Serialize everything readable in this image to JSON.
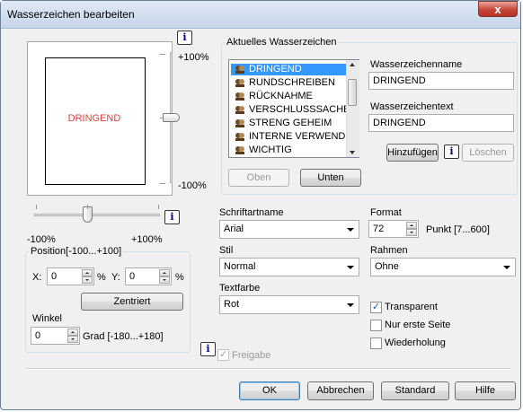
{
  "window": {
    "title": "Wasserzeichen bearbeiten",
    "close": "x"
  },
  "preview": {
    "text": "DRINGEND"
  },
  "slider_v": {
    "top": "+100%",
    "bottom": "-100%"
  },
  "slider_h": {
    "left": "-100%",
    "right": "+100%"
  },
  "info_glyph": "i",
  "position": {
    "group": "Position[-100...+100]",
    "x_label": "X:",
    "x_value": "0",
    "x_unit": "%",
    "y_label": "Y:",
    "y_value": "0",
    "y_unit": "%",
    "center": "Zentriert"
  },
  "angle": {
    "label": "Winkel",
    "value": "0",
    "unit": "Grad [-180...+180]"
  },
  "current": {
    "group": "Aktuelles Wasserzeichen",
    "items": [
      "DRINGEND",
      "RUNDSCHREIBEN",
      "RÜCKNAHME",
      "VERSCHLUSSSACHE",
      "STRENG GEHEIM",
      "INTERNE VERWEND.",
      "WICHTIG"
    ],
    "selected": 0,
    "up": "Oben",
    "down": "Unten"
  },
  "name": {
    "label": "Wasserzeichenname",
    "value": "DRINGEND"
  },
  "text": {
    "label": "Wasserzeichentext",
    "value": "DRINGEND"
  },
  "buttons": {
    "add": "Hinzufügen",
    "delete": "Löschen",
    "ok": "OK",
    "cancel": "Abbrechen",
    "standard": "Standard",
    "help": "Hilfe"
  },
  "font": {
    "label": "Schriftartname",
    "value": "Arial"
  },
  "format": {
    "label": "Format",
    "value": "72",
    "unit": "Punkt [7...600]"
  },
  "style": {
    "label": "Stil",
    "value": "Normal"
  },
  "frame": {
    "label": "Rahmen",
    "value": "Ohne"
  },
  "color": {
    "label": "Textfarbe",
    "value": "Rot"
  },
  "options": {
    "transparent": {
      "label": "Transparent",
      "checked": true
    },
    "first_page": {
      "label": "Nur erste Seite",
      "checked": false
    },
    "repeat": {
      "label": "Wiederholung",
      "checked": false
    }
  },
  "share": {
    "label": "Freigabe",
    "checked": true,
    "enabled": false
  }
}
